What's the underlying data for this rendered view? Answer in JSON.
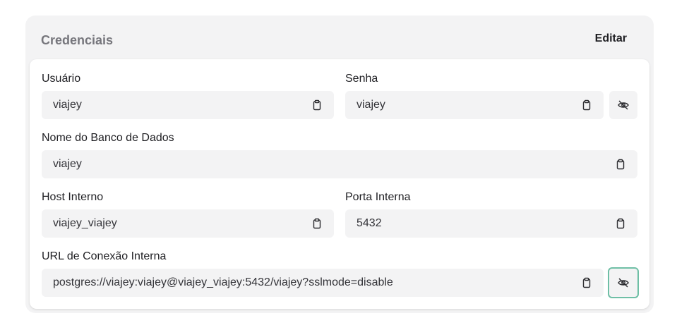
{
  "card": {
    "title": "Credenciais",
    "edit_label": "Editar"
  },
  "fields": {
    "user": {
      "label": "Usuário",
      "value": "viajey"
    },
    "password": {
      "label": "Senha",
      "value": "viajey"
    },
    "db_name": {
      "label": "Nome do Banco de Dados",
      "value": "viajey"
    },
    "internal_host": {
      "label": "Host Interno",
      "value": "viajey_viajey"
    },
    "internal_port": {
      "label": "Porta Interna",
      "value": "5432"
    },
    "internal_url": {
      "label": "URL de Conexão Interna",
      "value": "postgres://viajey:viajey@viajey_viajey:5432/viajey?sslmode=disable"
    }
  },
  "icons": {
    "copy": "clipboard-icon",
    "toggle_visibility": "eye-off-icon"
  },
  "colors": {
    "focus_ring": "#6fbfa6",
    "field_bg": "#f3f3f4",
    "title": "#76767c"
  }
}
